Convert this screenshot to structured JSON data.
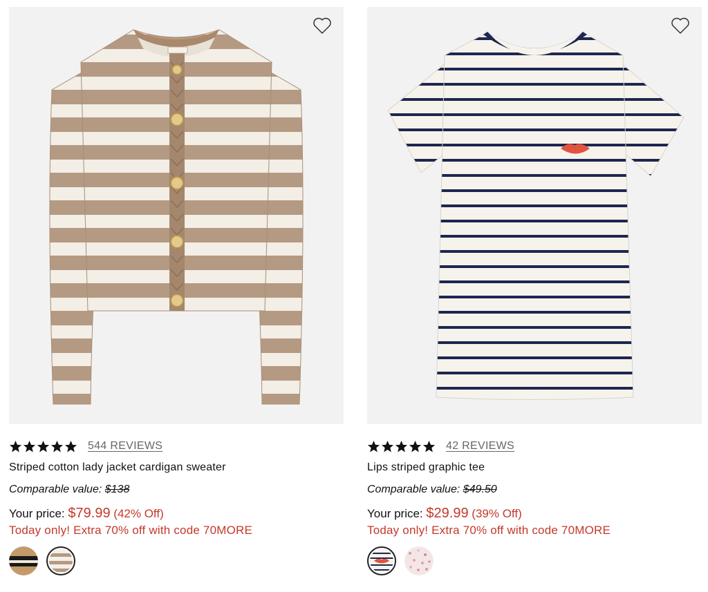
{
  "products": [
    {
      "name": "Striped cotton lady jacket cardigan sweater",
      "reviews": "544 REVIEWS",
      "rating": 5,
      "comparable_label": "Comparable value:",
      "comparable_price": "$138",
      "your_price_label": "Your price:",
      "price": "$79.99",
      "discount": "(42% Off)",
      "promo": "Today only! Extra 70% off with code 70MORE",
      "image_icon": "striped-cardigan-image",
      "favorite_icon": "heart-icon",
      "swatches": [
        {
          "name": "tan-black-stripe-swatch",
          "selected": false
        },
        {
          "name": "tan-ivory-stripe-swatch",
          "selected": true
        }
      ]
    },
    {
      "name": "Lips striped graphic tee",
      "reviews": "42 REVIEWS",
      "rating": 5,
      "comparable_label": "Comparable value:",
      "comparable_price": "$49.50",
      "your_price_label": "Your price:",
      "price": "$29.99",
      "discount": "(39% Off)",
      "promo": "Today only! Extra 70% off with code 70MORE",
      "image_icon": "striped-tee-image",
      "favorite_icon": "heart-icon",
      "swatches": [
        {
          "name": "lips-stripe-swatch",
          "selected": true
        },
        {
          "name": "pink-dot-swatch",
          "selected": false
        }
      ]
    }
  ],
  "colors": {
    "sale_red": "#c4382a",
    "image_bg": "#f2f2f2",
    "cardigan_tan": "#b49a82",
    "tee_navy": "#1e2650"
  }
}
